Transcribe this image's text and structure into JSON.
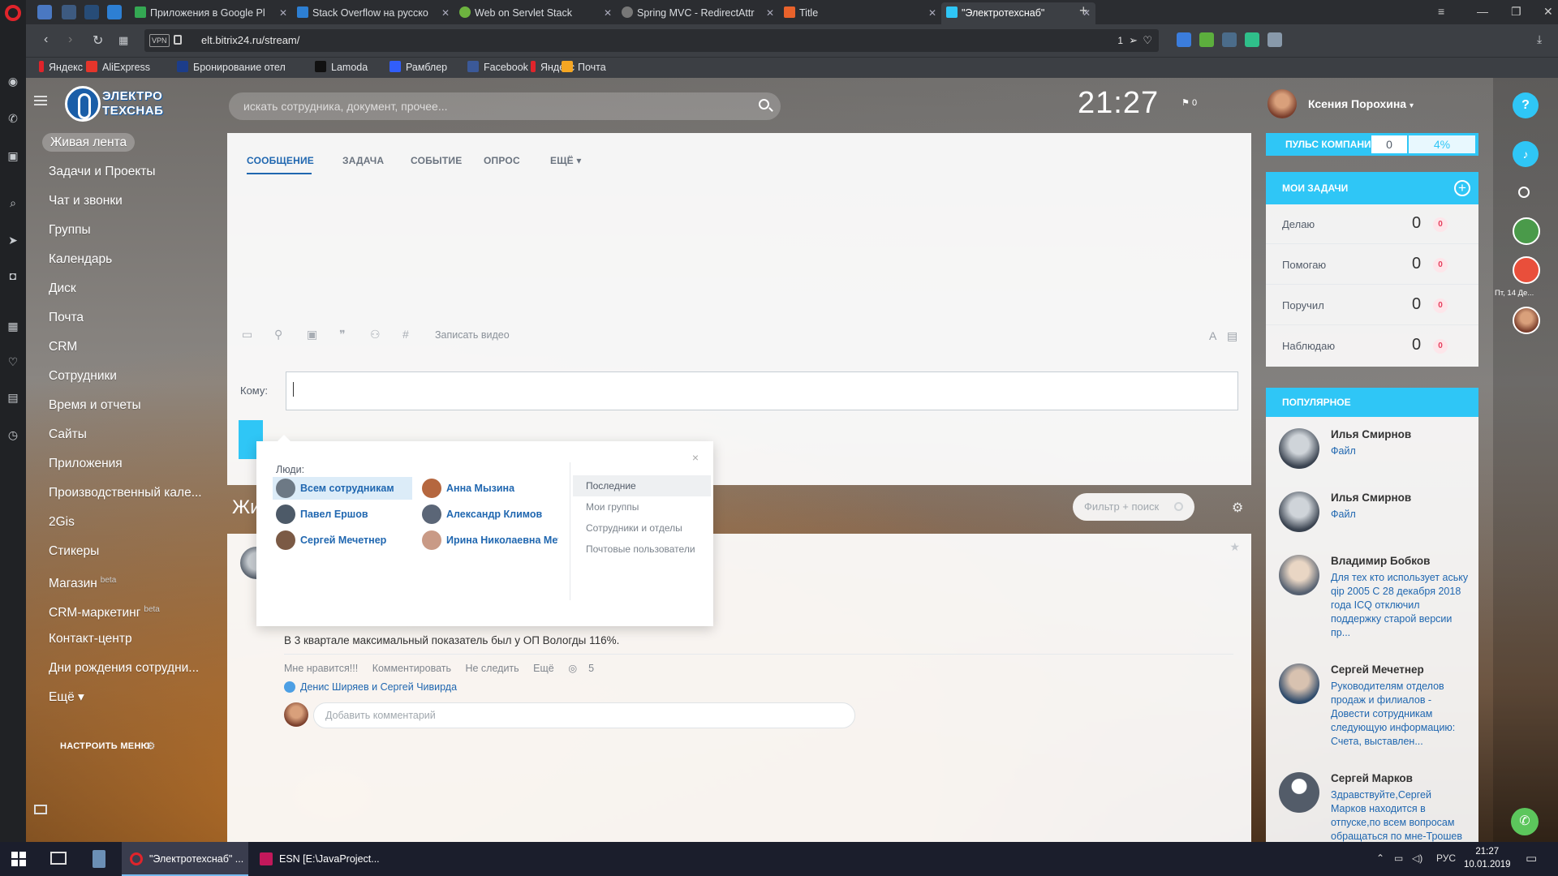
{
  "browser": {
    "tabs": [
      {
        "title": "Приложения в Google Pl",
        "color": "#34a853"
      },
      {
        "title": "Stack Overflow на русско",
        "color": "#2d7fd3"
      },
      {
        "title": "Web on Servlet Stack",
        "color": "#6db33f"
      },
      {
        "title": "Spring MVC - RedirectAttr",
        "color": "#777777"
      },
      {
        "title": "Title",
        "color": "#e8622b"
      },
      {
        "title": "\"Электротехснаб\"",
        "color": "#2fc6f6"
      }
    ],
    "url": "elt.bitrix24.ru/stream/",
    "vpn_label": "VPN",
    "addr_count": "1",
    "bookmarks": [
      {
        "label": "Яндекс",
        "color": "#e0242b"
      },
      {
        "label": "AliExpress",
        "color": "#e5352b"
      },
      {
        "label": "Бронирование отел",
        "color": "#1c3d8a"
      },
      {
        "label": "Lamoda",
        "color": "#111111"
      },
      {
        "label": "Рамблер",
        "color": "#315efb"
      },
      {
        "label": "Facebook",
        "color": "#3b5998"
      },
      {
        "label": "Яндекс",
        "color": "#e0242b"
      },
      {
        "label": "Почта",
        "color": "#f5a623"
      }
    ]
  },
  "portal": {
    "logo_line1": "ЭЛЕКТРО",
    "logo_line2": "ТЕХСНАБ",
    "search_placeholder": "искать сотрудника, документ, прочее...",
    "clock": "21:27",
    "flag_count": "0",
    "user_name": "Ксения Порохина",
    "user_caret": "▾"
  },
  "menu": {
    "items": [
      {
        "label": "Живая лента",
        "sup": ""
      },
      {
        "label": "Задачи и Проекты",
        "sup": ""
      },
      {
        "label": "Чат и звонки",
        "sup": ""
      },
      {
        "label": "Группы",
        "sup": ""
      },
      {
        "label": "Календарь",
        "sup": ""
      },
      {
        "label": "Диск",
        "sup": ""
      },
      {
        "label": "Почта",
        "sup": ""
      },
      {
        "label": "CRM",
        "sup": ""
      },
      {
        "label": "Сотрудники",
        "sup": ""
      },
      {
        "label": "Время и отчеты",
        "sup": ""
      },
      {
        "label": "Сайты",
        "sup": ""
      },
      {
        "label": "Приложения",
        "sup": ""
      },
      {
        "label": "Производственный кале...",
        "sup": ""
      },
      {
        "label": "2Gis",
        "sup": ""
      },
      {
        "label": "Стикеры",
        "sup": ""
      },
      {
        "label": "Магазин",
        "sup": "beta"
      },
      {
        "label": "CRM-маркетинг",
        "sup": "beta"
      },
      {
        "label": "Контакт-центр",
        "sup": ""
      },
      {
        "label": "Дни рождения сотрудни...",
        "sup": ""
      },
      {
        "label": "Ещё ▾",
        "sup": ""
      }
    ],
    "configure": "НАСТРОИТЬ МЕНЮ"
  },
  "composer": {
    "tabs": [
      "СООБЩЕНИЕ",
      "ЗАДАЧА",
      "СОБЫТИЕ",
      "ОПРОС",
      "ЕЩЁ ▾"
    ],
    "record_video": "Записать видео",
    "to_label": "Кому:"
  },
  "selector": {
    "close": "×",
    "people_label": "Люди:",
    "people": [
      {
        "name": "Всем сотрудникам",
        "color": "#6d7985"
      },
      {
        "name": "Анна Мызина",
        "color": "#b5673f"
      },
      {
        "name": "Павел Ершов",
        "color": "#4d5a68"
      },
      {
        "name": "Александр Климов",
        "color": "#5b6677"
      },
      {
        "name": "Сергей Мечетнер",
        "color": "#7b5a45"
      },
      {
        "name": "Ирина Николаевна Мет...",
        "color": "#c99a86"
      }
    ],
    "categories": [
      "Последние",
      "Мои группы",
      "Сотрудники и отделы",
      "Почтовые пользователи"
    ]
  },
  "feed": {
    "title": "Жи",
    "filter_placeholder": "Фильтр + поиск",
    "post": {
      "text": "В 3 квартале максимальный показатель был у ОП Вологды 116%.",
      "actions": [
        "Мне нравится!!!",
        "Комментировать",
        "Не следить",
        "Ещё"
      ],
      "views": "5",
      "likers": "Денис Ширяев и Сергей Чивирда",
      "comment_placeholder": "Добавить комментарий"
    }
  },
  "right": {
    "pulse_label": "ПУЛЬС КОМПАНИИ",
    "pulse_value": "0",
    "pulse_percent": "4%",
    "tasks_title": "МОИ ЗАДАЧИ",
    "tasks": [
      {
        "label": "Делаю",
        "count": "0",
        "badge": "0"
      },
      {
        "label": "Помогаю",
        "count": "0",
        "badge": "0"
      },
      {
        "label": "Поручил",
        "count": "0",
        "badge": "0"
      },
      {
        "label": "Наблюдаю",
        "count": "0",
        "badge": "0"
      }
    ],
    "popular_title": "ПОПУЛЯРНОЕ",
    "popular": [
      {
        "name": "Илья Смирнов",
        "text": "Файл"
      },
      {
        "name": "Илья Смирнов",
        "text": "Файл"
      },
      {
        "name": "Владимир Бобков",
        "text": "Для тех кто использует аську qip 2005 С 28 декабря 2018 года ICQ отключил поддержку старой версии пр..."
      },
      {
        "name": "Сергей Мечетнер",
        "text": "Руководителям отделов продаж и филиалов - Довести сотрудникам следующую информацию: Счета, выставлен..."
      },
      {
        "name": "Сергей Марков",
        "text": "Здравствуйте,Сергей Марков находится в отпуске,по всем вопросам обращаться по мне-Трошев"
      }
    ],
    "rbar_date": "Пт, 14 Де..."
  },
  "taskbar": {
    "apps": [
      {
        "label": "\"Электротехснаб\" ...",
        "color": "#e0242b"
      },
      {
        "label": "ESN [E:\\JavaProject...",
        "color": "#c2185b"
      }
    ],
    "lang": "РУС",
    "time": "21:27",
    "date": "10.01.2019"
  }
}
